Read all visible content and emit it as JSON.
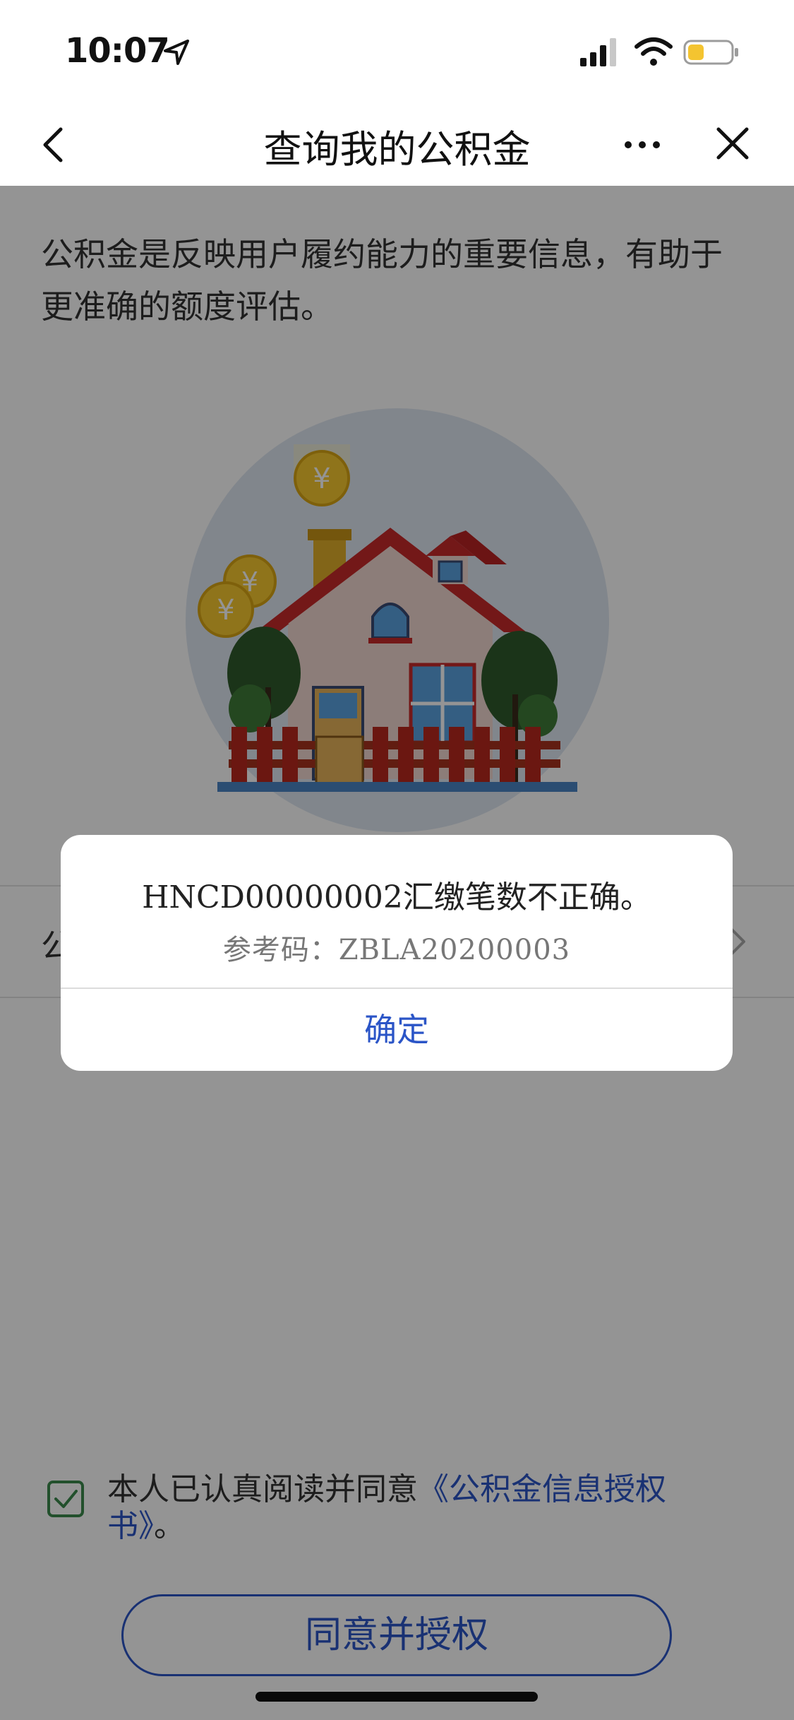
{
  "status_bar": {
    "time": "10:07"
  },
  "nav": {
    "title": "查询我的公积金"
  },
  "intro_text": "公积金是反映用户履约能力的重要信息，有助于更准确的额度评估。",
  "row": {
    "label": "公"
  },
  "agreement": {
    "prefix": "本人已认真阅读并同意",
    "link": "《公积金信息授权书》",
    "suffix": "。",
    "checked": true
  },
  "agree_button_label": "同意并授权",
  "dialog": {
    "message": "HNCD00000002汇缴笔数不正确。",
    "ref": "参考码：ZBLA20200003",
    "ok_label": "确定"
  },
  "hero": {
    "coin_symbol": "¥"
  },
  "colors": {
    "accent": "#2b55c7",
    "check_green": "#3c8a4c"
  }
}
